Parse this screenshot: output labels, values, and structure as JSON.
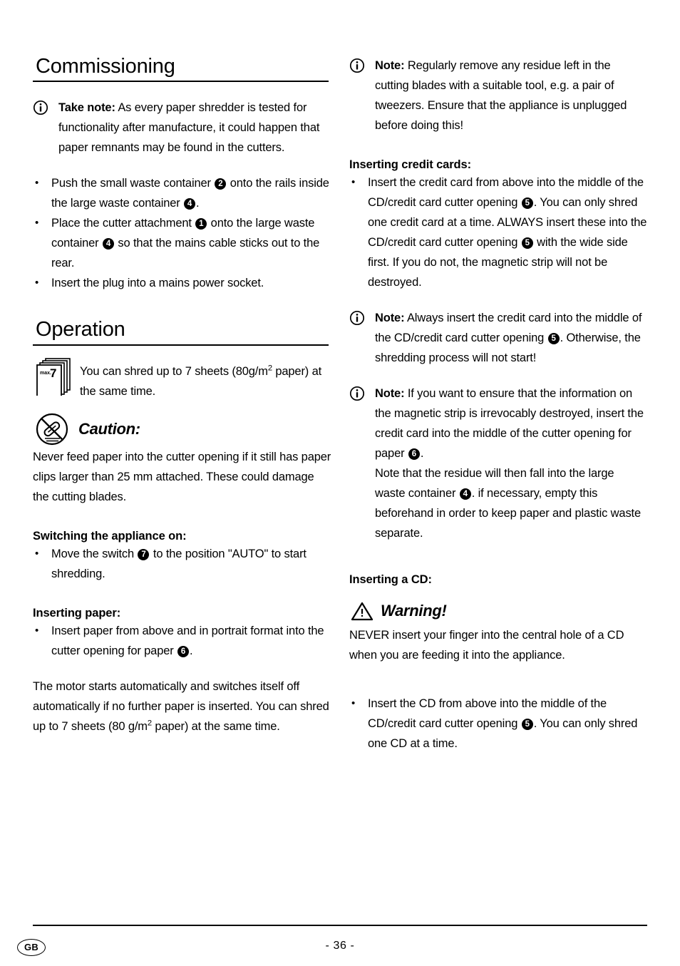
{
  "document": {
    "language_badge": "GB",
    "page_label": "- 36 -"
  },
  "left_column": {
    "heading_commissioning": "Commissioning",
    "take_note": {
      "icon": "info-icon",
      "label": "Take note:",
      "text": " As every paper shredder is tested for functionality after manufacture, it could happen that paper remnants may be found in the cutters."
    },
    "setup_bullets": [
      "Push the small waste container ② onto the rails inside the large waste container ④.",
      "Place the cutter attachment ① onto the large waste container ④ so that the mains cable sticks out to the rear.",
      "Insert the plug into a mains power socket."
    ],
    "heading_operation": "Operation",
    "capacity_note": {
      "icon": "paper-stack-icon",
      "icon_label_small": "max.",
      "icon_label_number": "7",
      "text_part1": "You can shred up to 7 sheets (80g/m",
      "text_sup": "2",
      "text_part2": " paper) at the same time."
    },
    "caution": {
      "icon": "no-paperclip-icon",
      "title": "Caution:",
      "text": "Never feed paper into the cutter opening if it still has paper clips larger than 25 mm attached. These could damage the cutting blades."
    },
    "switching_on": {
      "heading": "Switching the appliance on:",
      "bullet": "Move the switch ⑦ to the position \"AUTO\" to start shredding."
    },
    "inserting_paper": {
      "heading": "Inserting paper:",
      "bullet": "Insert paper from above and in portrait format into the cutter opening for paper ⑥."
    },
    "motor_paragraph": {
      "part1": "The motor starts automatically and switches itself off automatically if no further paper is inserted. You can shred up to 7 sheets (80 g/m",
      "sup": "2",
      "part2": " paper) at the same time."
    }
  },
  "right_column": {
    "residue_note": {
      "icon": "info-icon",
      "label": "Note:",
      "text": " Regularly remove any residue left in the cutting blades with a suitable tool, e.g. a pair of tweezers. Ensure that the appliance is unplugged before doing this!"
    },
    "inserting_credit_cards": {
      "heading": "Inserting credit cards:",
      "bullet": "Insert the credit card from above into the middle of the CD/credit card cutter opening ⑤. You can only shred one credit card at a time. ALWAYS insert these into the CD/credit card cutter opening ⑤ with the wide side first. If you do not, the magnetic strip will not be destroyed."
    },
    "note_middle": {
      "icon": "info-icon",
      "label": "Note:",
      "text": " Always insert the credit card into the middle of the CD/credit card cutter opening ⑤. Otherwise, the shredding process will not start!"
    },
    "note_magnetic": {
      "icon": "info-icon",
      "label": "Note:",
      "text_a": " If you want to ensure that the information on the magnetic strip is irrevocably destroyed, insert the credit card into the middle of the cutter opening for paper ⑥.",
      "text_b": "Note that the residue will then fall into the large waste container ④. if necessary, empty this beforehand in order to keep paper and plastic waste separate."
    },
    "inserting_cd": {
      "heading": "Inserting a CD:",
      "warning": {
        "icon": "warning-triangle-icon",
        "title": "Warning!",
        "text": "NEVER insert your finger into the central hole of a CD when you are feeding it into the appliance."
      },
      "bullet": "Insert the CD from above into the middle of the CD/credit card cutter opening ⑤. You can only shred one CD at a time."
    }
  },
  "refs": {
    "one": "1",
    "two": "2",
    "four": "4",
    "five": "5",
    "six": "6",
    "seven": "7"
  }
}
